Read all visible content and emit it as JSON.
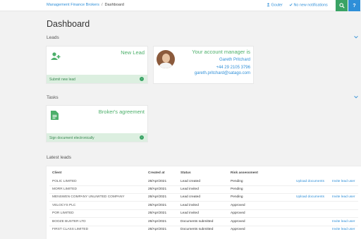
{
  "topbar": {
    "breadcrumb": [
      "Management Finance Brokers",
      "Dashboard"
    ],
    "breadcrumb_sep": "/",
    "user_name": "Gouter",
    "notifications": "No new notifications",
    "help": "?"
  },
  "page": {
    "title": "Dashboard"
  },
  "leads_section": {
    "heading": "Leads",
    "new_lead_card": {
      "title": "New Lead",
      "action": "Submit new lead"
    },
    "manager_card": {
      "title": "Your account manager is",
      "name": "Gareth Pritchard",
      "phone": "+44 29 2105 3796",
      "email": "gareth.pritchard@satago.com"
    }
  },
  "tasks_section": {
    "heading": "Tasks",
    "brokers_card": {
      "title": "Broker's agreement",
      "action": "Sign document electronically"
    }
  },
  "latest_leads": {
    "heading": "Latest leads",
    "columns": [
      "Client",
      "Created at",
      "Status",
      "Risk assessment"
    ],
    "rows": [
      {
        "client": "POLIC LIMITED",
        "created": "28/Apr/2021",
        "status": "Lead created",
        "risk": "Pending",
        "upload": "Upload documents",
        "invite": "Invite lead user"
      },
      {
        "client": "MORR LIMITED",
        "created": "28/Apr/2021",
        "status": "Lead invited",
        "risk": "Pending",
        "upload": "",
        "invite": ""
      },
      {
        "client": "MENSWEN COMPANY UNLIMITED COMPANY",
        "created": "28/Apr/2021",
        "status": "Lead created",
        "risk": "Pending",
        "upload": "Upload documents",
        "invite": "Invite lead user"
      },
      {
        "client": "VELOCYS PLC",
        "created": "28/Apr/2021",
        "status": "Lead invited",
        "risk": "Approved",
        "upload": "",
        "invite": ""
      },
      {
        "client": "POR LIMITED",
        "created": "28/Apr/2021",
        "status": "Lead invited",
        "risk": "Approved",
        "upload": "",
        "invite": ""
      },
      {
        "client": "BOOZE BUSTER LTD",
        "created": "28/Apr/2021",
        "status": "Documents submitted",
        "risk": "Approved",
        "upload": "",
        "invite": "Invite lead user"
      },
      {
        "client": "FIRST CLASS LIMITED",
        "created": "28/Apr/2021",
        "status": "Documents submitted",
        "risk": "Approved",
        "upload": "",
        "invite": "Invite lead user"
      }
    ]
  },
  "colors": {
    "accent_green": "#3aa365",
    "link_blue": "#2f8fd8",
    "card_footer": "#dcefe0"
  },
  "icons": [
    "user-icon",
    "check-icon",
    "search-icon",
    "help-icon",
    "add-user-icon",
    "document-icon",
    "chevron-down-icon",
    "arrow-right-icon"
  ]
}
